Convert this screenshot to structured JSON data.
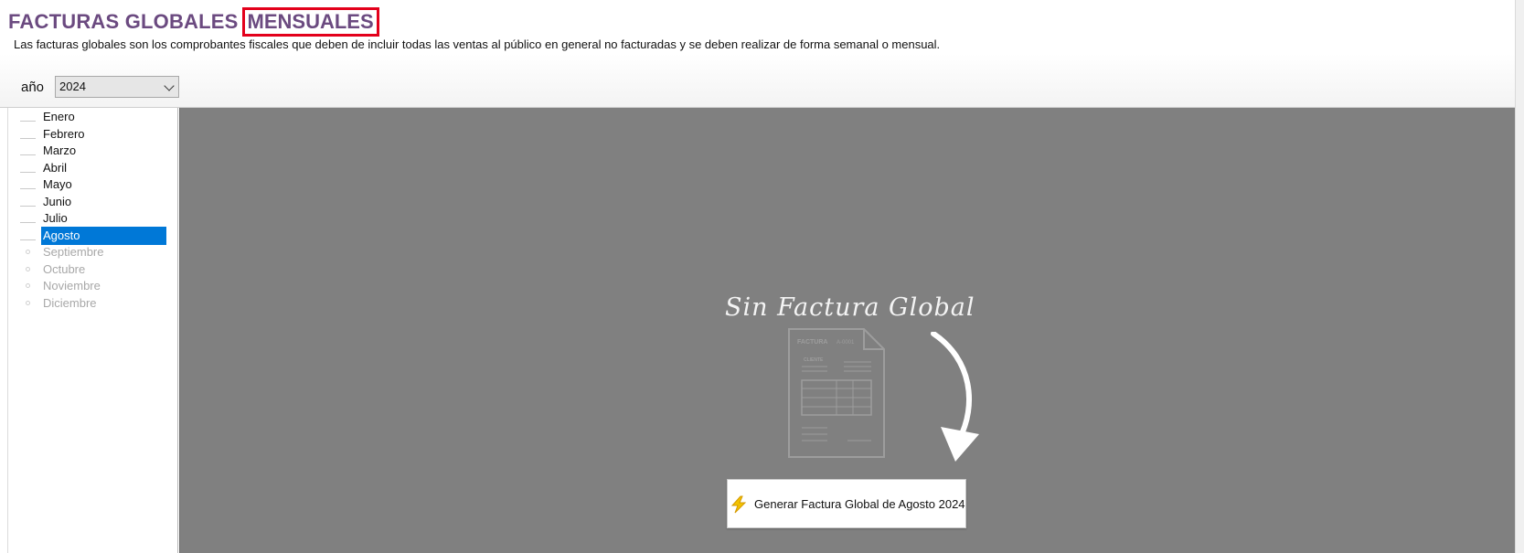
{
  "header": {
    "title": "FACTURAS GLOBALES",
    "title_highlight": "MENSUALES",
    "subtitle": "Las facturas globales son los comprobantes fiscales que deben de incluir todas las ventas al público en general no facturadas y se deben realizar de forma semanal o mensual.",
    "year_label": "año",
    "year_selected": "2024",
    "colors": {
      "title": "#6b4a80",
      "highlight_border": "#e3001b"
    }
  },
  "months": [
    {
      "label": "Enero",
      "state": "available"
    },
    {
      "label": "Febrero",
      "state": "available"
    },
    {
      "label": "Marzo",
      "state": "available"
    },
    {
      "label": "Abril",
      "state": "available"
    },
    {
      "label": "Mayo",
      "state": "available"
    },
    {
      "label": "Junio",
      "state": "available"
    },
    {
      "label": "Julio",
      "state": "available"
    },
    {
      "label": "Agosto",
      "state": "selected"
    },
    {
      "label": "Septiembre",
      "state": "disabled"
    },
    {
      "label": "Octubre",
      "state": "disabled"
    },
    {
      "label": "Noviembre",
      "state": "disabled"
    },
    {
      "label": "Diciembre",
      "state": "disabled"
    }
  ],
  "main": {
    "empty_title": "Sin Factura Global",
    "illustration": {
      "doc_title": "FACTURA",
      "doc_number": "A-0001",
      "doc_client": "CLIENTE"
    },
    "generate_button": "Generar Factura Global de Agosto 2024",
    "background": "#808080"
  },
  "icons": [
    "chevron-down-icon",
    "invoice-document-icon",
    "curved-arrow-icon",
    "lightning-bolt-icon"
  ]
}
